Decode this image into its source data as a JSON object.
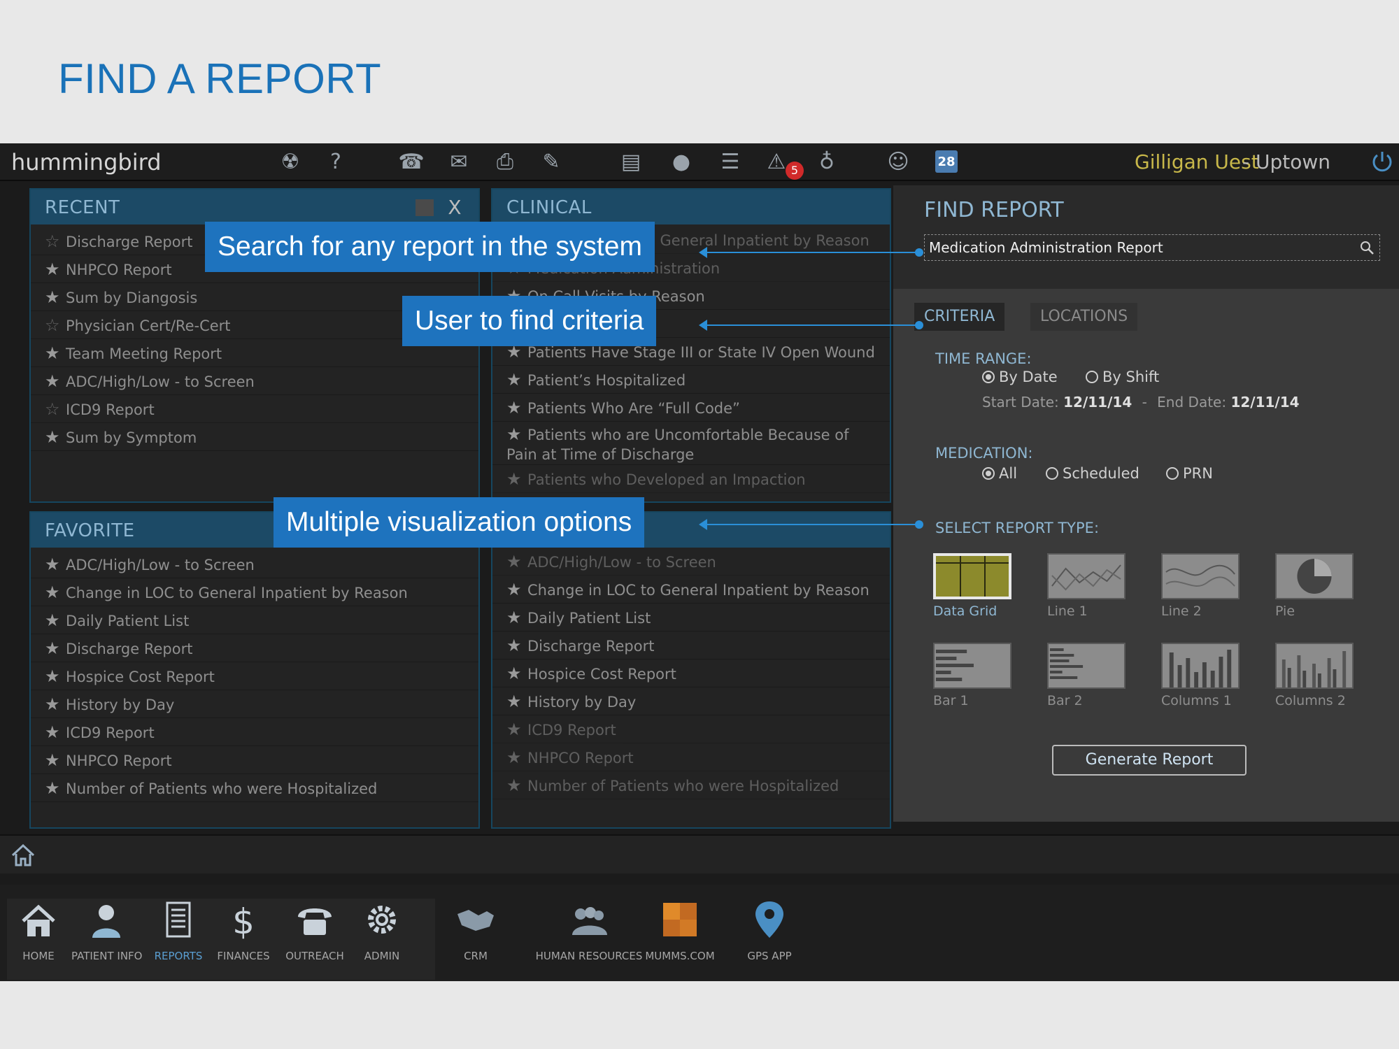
{
  "slide": {
    "title": "FIND A REPORT"
  },
  "topbar": {
    "brand": "hummingbird",
    "alert_count": "5",
    "calendar_day": "28",
    "user_name": "Gilligan Uest",
    "user_location": "- Uptown",
    "icons": [
      "radiation-icon",
      "help-icon",
      "phone-icon",
      "mail-icon",
      "print-icon",
      "pencil-icon",
      "report-icon",
      "chat-icon",
      "list-icon",
      "alert-icon",
      "lightbulb-icon",
      "contact-icon",
      "calendar-icon",
      "power-icon"
    ]
  },
  "recent": {
    "title": "RECENT",
    "close_label": "X",
    "items": [
      {
        "label": "Discharge Report",
        "starred": false
      },
      {
        "label": "NHPCO Report",
        "starred": true
      },
      {
        "label": "Sum by Diangosis",
        "starred": true
      },
      {
        "label": "Physician Cert/Re-Cert",
        "starred": false
      },
      {
        "label": "Team Meeting Report",
        "starred": true
      },
      {
        "label": "ADC/High/Low - to Screen",
        "starred": true
      },
      {
        "label": "ICD9 Report",
        "starred": false
      },
      {
        "label": "Sum by Symptom",
        "starred": true
      }
    ]
  },
  "clinical": {
    "title": "CLINICAL",
    "items": [
      {
        "label": "Change in LOC to General Inpatient by Reason"
      },
      {
        "label": "Medication Administration"
      },
      {
        "label": "On Call Visits by Reason"
      },
      {
        "label": ""
      },
      {
        "label": "Patients Have Stage III or State IV Open Wound"
      },
      {
        "label": "Patient’s Hospitalized"
      },
      {
        "label": "Patients Who Are “Full Code”"
      },
      {
        "label": "Patients who are Uncomfortable Because of Pain at Time of Discharge"
      },
      {
        "label": "Patients who Developed an Impaction"
      }
    ]
  },
  "favorite": {
    "title": "FAVORITE",
    "items": [
      {
        "label": "ADC/High/Low - to Screen"
      },
      {
        "label": "Change in LOC to General Inpatient by Reason"
      },
      {
        "label": "Daily Patient List"
      },
      {
        "label": "Discharge Report"
      },
      {
        "label": "Hospice Cost Report"
      },
      {
        "label": "History by Day"
      },
      {
        "label": "ICD9 Report"
      },
      {
        "label": "NHPCO Report"
      },
      {
        "label": "Number of Patients who were Hospitalized"
      }
    ]
  },
  "second_list": {
    "items": [
      {
        "label": "ADC/High/Low - to Screen"
      },
      {
        "label": "Change in LOC to General Inpatient by Reason"
      },
      {
        "label": "Daily Patient List"
      },
      {
        "label": "Discharge Report"
      },
      {
        "label": "Hospice Cost Report"
      },
      {
        "label": "History by Day"
      },
      {
        "label": "ICD9 Report"
      },
      {
        "label": "NHPCO Report"
      },
      {
        "label": "Number of Patients who were Hospitalized"
      }
    ]
  },
  "find_report": {
    "title": "FIND REPORT",
    "search_value": "Medication Administration Report",
    "tabs": {
      "criteria": "CRITERIA",
      "locations": "LOCATIONS"
    },
    "time_range_label": "TIME RANGE:",
    "by_date": "By Date",
    "by_shift": "By Shift",
    "start_date_label": "Start Date:",
    "start_date": "12/11/14",
    "date_sep": "-",
    "end_date_label": "End Date:",
    "end_date": "12/11/14",
    "medication_label": "MEDICATION:",
    "med_all": "All",
    "med_scheduled": "Scheduled",
    "med_prn": "PRN",
    "report_type_label": "SELECT REPORT TYPE:",
    "report_types": [
      "Data Grid",
      "Line 1",
      "Line 2",
      "Pie",
      "Bar 1",
      "Bar 2",
      "Columns 1",
      "Columns 2"
    ],
    "selected_report_type": "Data Grid",
    "generate_label": "Generate Report"
  },
  "callouts": {
    "search": "Search for any report in the system",
    "criteria": "User to find criteria",
    "visualization": "Multiple visualization options"
  },
  "nav": {
    "items": [
      {
        "label": "HOME",
        "icon": "home-icon"
      },
      {
        "label": "PATIENT INFO",
        "icon": "patient-icon"
      },
      {
        "label": "REPORTS",
        "icon": "reports-icon",
        "active": true
      },
      {
        "label": "FINANCES",
        "icon": "dollar-icon"
      },
      {
        "label": "OUTREACH",
        "icon": "telephone-icon"
      },
      {
        "label": "ADMIN",
        "icon": "gear-icon"
      },
      {
        "label": "CRM",
        "icon": "handshake-icon"
      },
      {
        "label": "HUMAN RESOURCES",
        "icon": "people-icon"
      },
      {
        "label": "MUMMS.COM",
        "icon": "mumms-logo-icon"
      },
      {
        "label": "GPS APP",
        "icon": "map-pin-icon"
      }
    ]
  },
  "colors": {
    "accent": "#1e73be",
    "panel_header": "#1c4a66",
    "header_text": "#8fb7d2",
    "user_name": "#c8b84a"
  }
}
